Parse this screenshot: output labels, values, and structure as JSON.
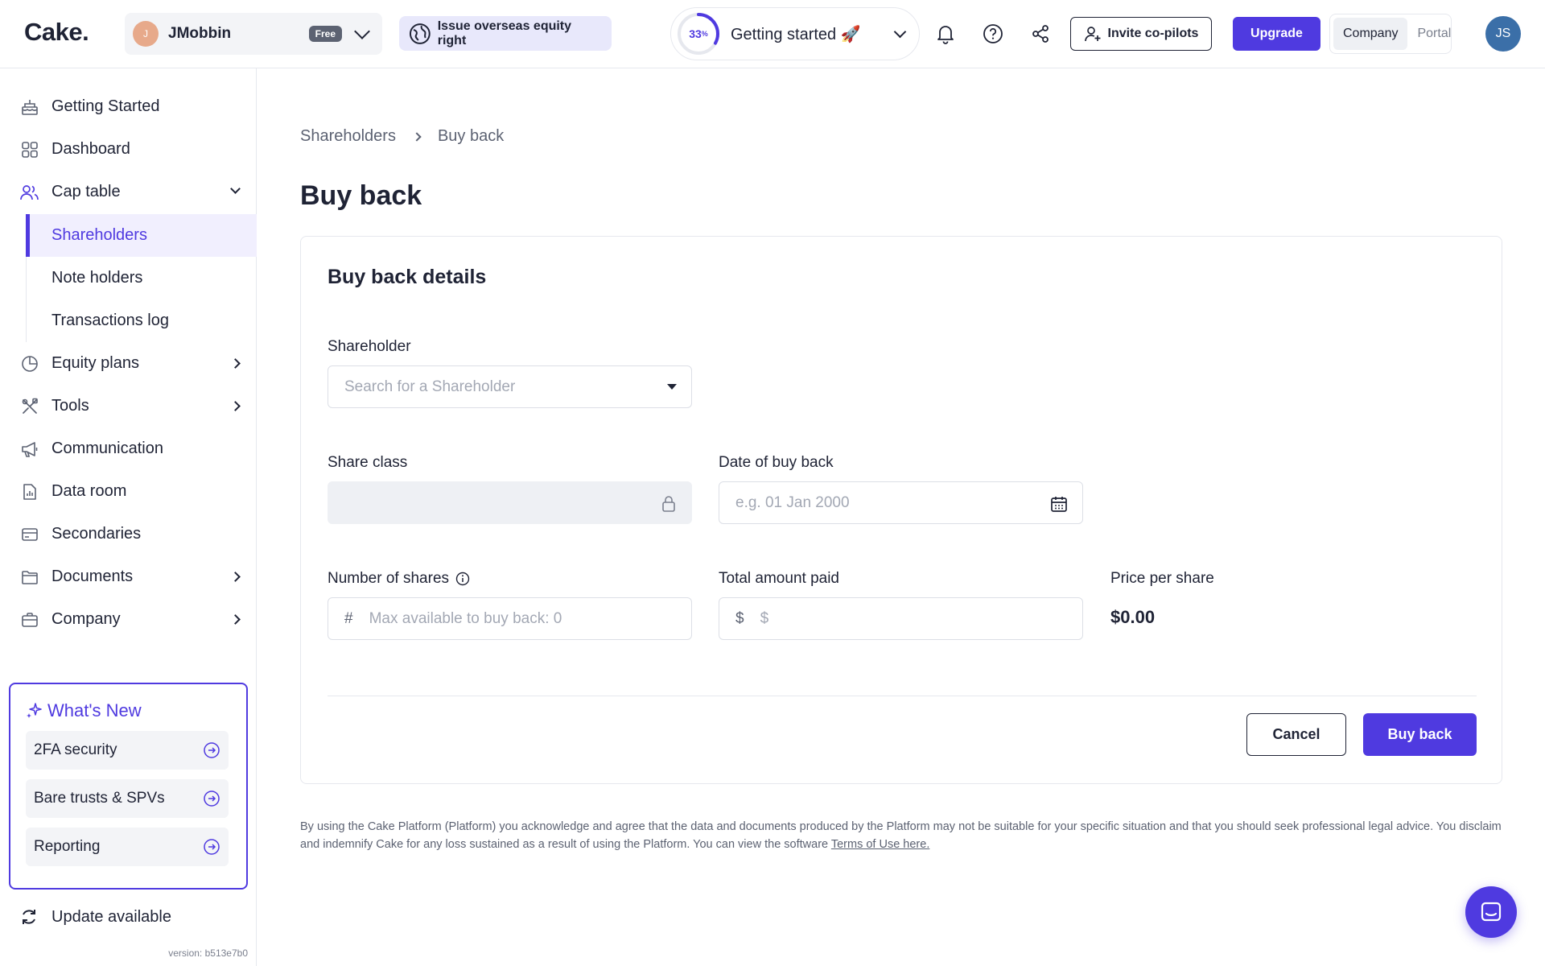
{
  "header": {
    "logo": "Cake.",
    "company": {
      "avatar_initial": "J",
      "name": "JMobbin",
      "plan": "Free"
    },
    "announcement": "Issue overseas equity right",
    "getting_started": {
      "progress_text": "33",
      "progress_unit": "%",
      "progress_value": 0.33,
      "label": "Getting started 🚀"
    },
    "invite_label": "Invite co-pilots",
    "upgrade_label": "Upgrade",
    "view_toggle": [
      "Company",
      "Portal"
    ],
    "user_initials": "JS",
    "accent_color": "#4f3ae0"
  },
  "sidebar": {
    "items": [
      {
        "label": "Getting Started",
        "icon": "cake-icon"
      },
      {
        "label": "Dashboard",
        "icon": "grid-icon"
      },
      {
        "label": "Cap table",
        "icon": "users-icon"
      },
      {
        "label": "Equity plans",
        "icon": "pie-chart-icon"
      },
      {
        "label": "Tools",
        "icon": "tools-icon"
      },
      {
        "label": "Communication",
        "icon": "megaphone-icon"
      },
      {
        "label": "Data room",
        "icon": "document-chart-icon"
      },
      {
        "label": "Secondaries",
        "icon": "card-icon"
      },
      {
        "label": "Documents",
        "icon": "folder-icon"
      },
      {
        "label": "Company",
        "icon": "briefcase-icon"
      }
    ],
    "cap_table_sub": [
      "Shareholders",
      "Note holders",
      "Transactions log"
    ],
    "whats_new": {
      "title": "What's New",
      "items": [
        "2FA security",
        "Bare trusts & SPVs",
        "Reporting"
      ]
    },
    "update_label": "Update available",
    "version": "version: b513e7b0"
  },
  "main": {
    "breadcrumb": [
      "Shareholders",
      "Buy back"
    ],
    "title": "Buy back",
    "card": {
      "title": "Buy back details",
      "shareholder_label": "Shareholder",
      "shareholder_placeholder": "Search for a Shareholder",
      "share_class_label": "Share class",
      "date_label": "Date of buy back",
      "date_placeholder": "e.g. 01 Jan 2000",
      "shares_label": "Number of shares",
      "shares_prefix": "#",
      "shares_placeholder": "Max available to buy back: 0",
      "amount_label": "Total amount paid",
      "amount_prefix": "$",
      "amount_placeholder": "$",
      "price_label": "Price per share",
      "price_value": "$0.00",
      "cancel_label": "Cancel",
      "submit_label": "Buy back"
    },
    "disclaimer": "By using the Cake Platform (Platform) you acknowledge and agree that the data and documents produced by the Platform may not be suitable for your specific situation and that you should seek professional legal advice. You disclaim and indemnify Cake for any loss sustained as a result of using the Platform. You can view the software ",
    "terms_link": "Terms of Use here."
  }
}
